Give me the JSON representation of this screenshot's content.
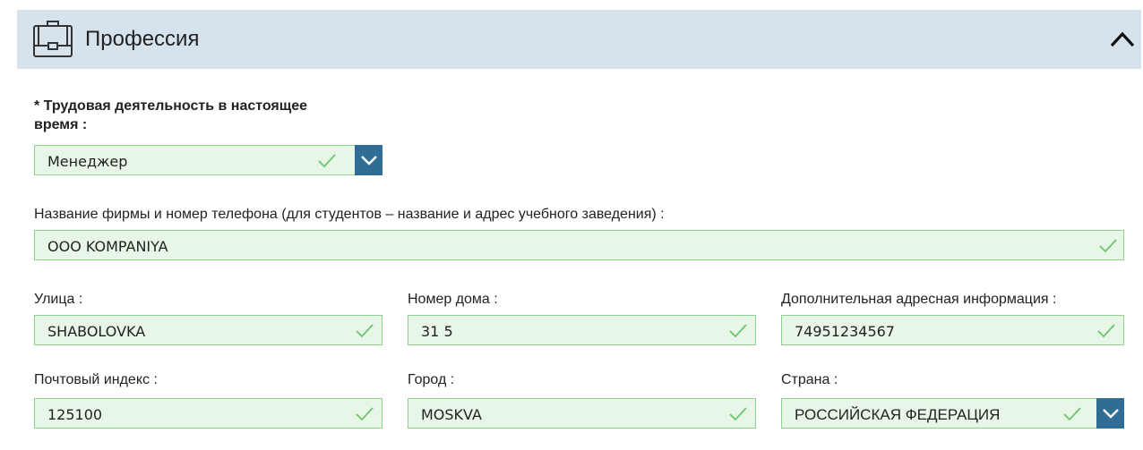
{
  "section": {
    "title": "Профессия",
    "icon": "briefcase-icon"
  },
  "colors": {
    "header_bg": "#d6e2ec",
    "field_bg": "#e7f6e7",
    "field_border": "#8fd18f",
    "check_green": "#6cc46c",
    "dropdown_btn": "#2f6d95"
  },
  "occupation": {
    "label_line1": "* Трудовая деятельность в настоящее",
    "label_line2": "время :",
    "value": "Менеджер"
  },
  "company": {
    "label": "Название фирмы и номер телефона (для студентов – название и адрес учебного заведения) :",
    "value": "OOO KOMPANIYA"
  },
  "street": {
    "label": "Улица :",
    "value": "SHABOLOVKA"
  },
  "house": {
    "label": "Номер дома :",
    "value": "31 5"
  },
  "extra_address": {
    "label": "Дополнительная адресная информация :",
    "value": "74951234567"
  },
  "postal_code": {
    "label": "Почтовый индекс :",
    "value": "125100"
  },
  "city": {
    "label": "Город :",
    "value": "MOSKVA"
  },
  "country": {
    "label": "Страна :",
    "value": "РОССИЙСКАЯ ФЕДЕРАЦИЯ"
  }
}
